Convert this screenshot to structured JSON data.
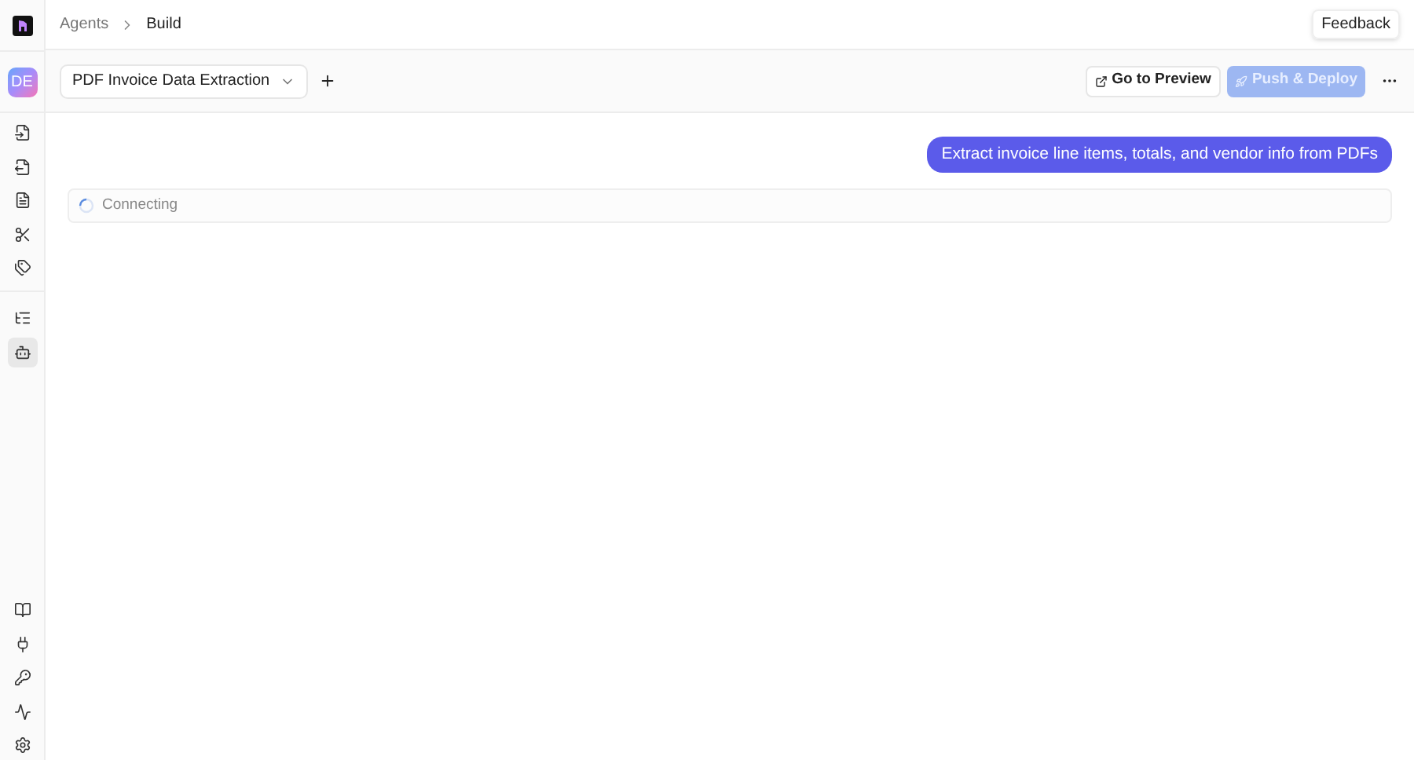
{
  "breadcrumb": [
    "Agents",
    "Build"
  ],
  "feedback_button": "Feedback",
  "avatar": {
    "initials": "DE"
  },
  "sidebar": {
    "top_items": [
      {
        "kind": "file-in",
        "selected": false
      },
      {
        "kind": "file-out",
        "selected": false
      },
      {
        "kind": "file",
        "selected": false
      },
      {
        "kind": "scissors",
        "selected": false
      },
      {
        "kind": "tags",
        "selected": false
      }
    ],
    "middle_items": [
      {
        "kind": "tree",
        "selected": false
      },
      {
        "kind": "bot",
        "selected": true
      }
    ],
    "bottom_items": [
      {
        "kind": "book",
        "selected": false
      },
      {
        "kind": "plug",
        "selected": false
      },
      {
        "kind": "key",
        "selected": false
      },
      {
        "kind": "activity",
        "selected": false
      },
      {
        "kind": "settings",
        "selected": false
      }
    ]
  },
  "toolbar": {
    "agent_select": "PDF Invoice Data Extraction",
    "preview_button": "Go to Preview",
    "deploy_button": {
      "label": "Push & Deploy",
      "disabled": true
    }
  },
  "message": "Extract invoice line items, totals, and vendor info from PDFs",
  "status": "Connecting"
}
